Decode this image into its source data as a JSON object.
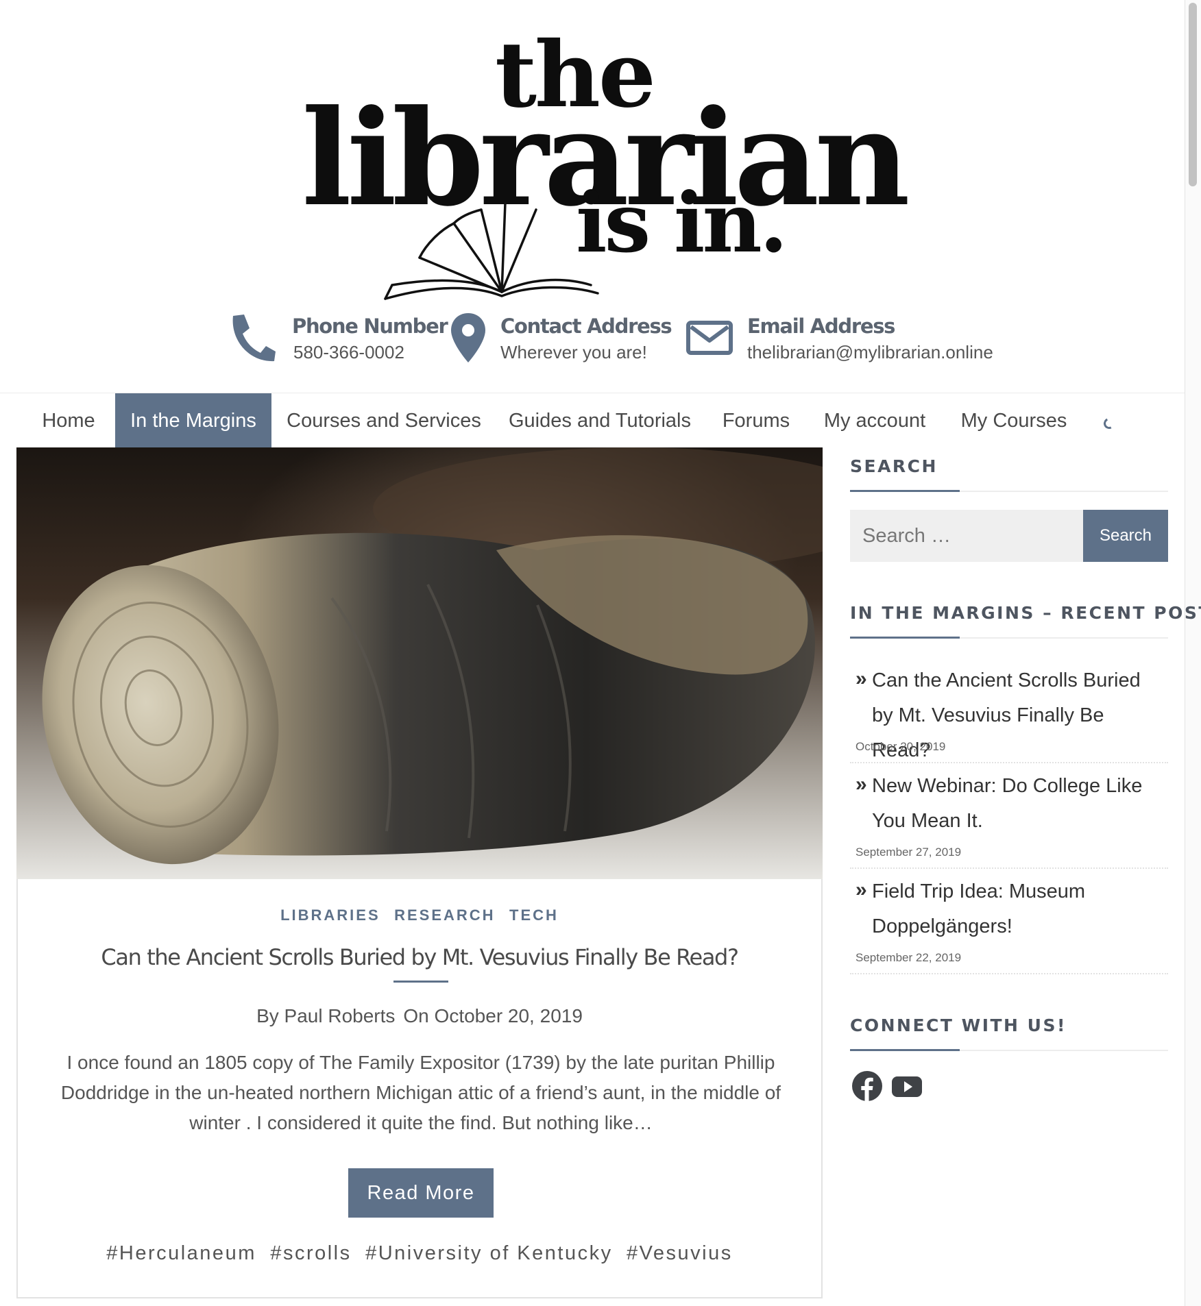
{
  "logo": {
    "line1": "the",
    "line2": "librarian",
    "line3": "is in."
  },
  "contact": {
    "phone": {
      "label": "Phone Number",
      "value": "580-366-0002",
      "icon": "phone-icon"
    },
    "address": {
      "label": "Contact Address",
      "value": "Wherever you are!",
      "icon": "map-pin-icon"
    },
    "email": {
      "label": "Email Address",
      "value": "thelibrarian@mylibrarian.online",
      "icon": "envelope-icon"
    }
  },
  "nav": {
    "items": [
      {
        "label": "Home"
      },
      {
        "label": "In the Margins",
        "active": true
      },
      {
        "label": "Courses and Services"
      },
      {
        "label": "Guides and Tutorials"
      },
      {
        "label": "Forums"
      },
      {
        "label": "My account"
      },
      {
        "label": "My Courses"
      }
    ]
  },
  "post": {
    "categories": [
      "LIBRARIES",
      "RESEARCH",
      "TECH"
    ],
    "title": "Can the Ancient Scrolls Buried by Mt. Vesuvius Finally Be Read?",
    "author": "By Paul Roberts",
    "date": "On October 20, 2019",
    "excerpt": "I once found an 1805 copy of The Family Expositor (1739) by the late puritan Phillip Doddridge in the un-heated northern Michigan attic of a friend’s aunt, in the middle of winter . I considered it quite the find. But nothing like…",
    "read_more": "Read More",
    "tags": [
      "#Herculaneum",
      "#scrolls",
      "#University of Kentucky",
      "#Vesuvius"
    ]
  },
  "sidebar": {
    "search": {
      "heading": "SEARCH",
      "placeholder": "Search …",
      "button": "Search"
    },
    "recent": {
      "heading": "IN THE MARGINS – RECENT POSTS",
      "posts": [
        {
          "title": "Can the Ancient Scrolls Buried by Mt. Vesuvius Finally Be Read?",
          "date": "October 20, 2019"
        },
        {
          "title": "New Webinar: Do College Like You Mean It.",
          "date": "September 27, 2019"
        },
        {
          "title": "Field Trip Idea: Museum Doppelgängers!",
          "date": "September 22, 2019"
        }
      ]
    },
    "connect": {
      "heading": "CONNECT WITH US!",
      "icons": [
        "facebook-icon",
        "youtube-icon"
      ]
    }
  },
  "colors": {
    "accent": "#5e7189",
    "text": "#444444",
    "icon": "#5e7189"
  }
}
